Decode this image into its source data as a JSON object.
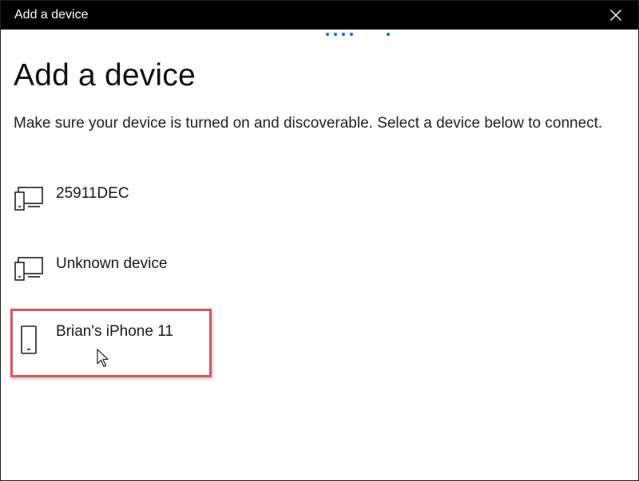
{
  "window": {
    "title": "Add a device"
  },
  "colors": {
    "titlebar_bg": "#000000",
    "accent": "#0a6fd6",
    "highlight_border": "#d9565f"
  },
  "icons": {
    "close": "close-icon",
    "desktop_device": "desktop-device-icon",
    "phone": "phone-icon"
  },
  "page": {
    "heading": "Add a device",
    "instructions": "Make sure your device is turned on and discoverable. Select a device below to connect."
  },
  "devices": [
    {
      "name": "25911DEC",
      "icon": "desktop-device-icon"
    },
    {
      "name": "Unknown device",
      "icon": "desktop-device-icon"
    },
    {
      "name": "Brian's iPhone 11",
      "icon": "phone-icon",
      "highlighted": true
    }
  ]
}
